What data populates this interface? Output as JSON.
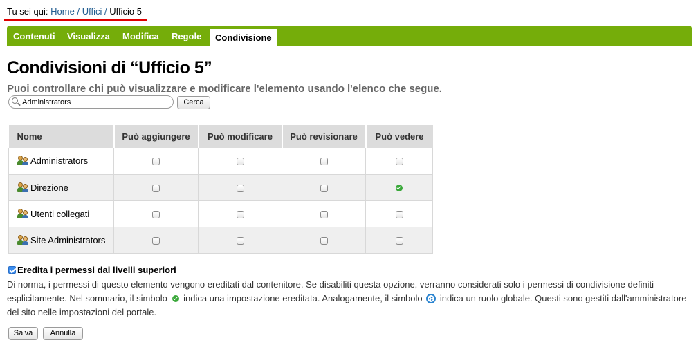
{
  "breadcrumb": {
    "prefix": "Tu sei qui:",
    "items": [
      "Home",
      "Uffici",
      "Ufficio 5"
    ],
    "separator": "/"
  },
  "tabs": [
    "Contenuti",
    "Visualizza",
    "Modifica",
    "Regole",
    "Condivisione"
  ],
  "active_tab": "Condivisione",
  "page": {
    "title": "Condivisioni di “Ufficio 5”",
    "subtitle": "Puoi controllare chi può visualizzare e modificare l'elemento usando l'elenco che segue."
  },
  "search": {
    "value": "Administrators",
    "button_label": "Cerca"
  },
  "table": {
    "headers": [
      "Nome",
      "Può aggiungere",
      "Può modificare",
      "Può revisionare",
      "Può vedere"
    ],
    "rows": [
      {
        "name": "Administrators",
        "permissions": [
          "unchecked",
          "unchecked",
          "unchecked",
          "unchecked"
        ]
      },
      {
        "name": "Direzione",
        "permissions": [
          "unchecked",
          "unchecked",
          "unchecked",
          "inherited"
        ]
      },
      {
        "name": "Utenti collegati",
        "permissions": [
          "unchecked",
          "unchecked",
          "unchecked",
          "unchecked"
        ]
      },
      {
        "name": "Site Administrators",
        "permissions": [
          "unchecked",
          "unchecked",
          "unchecked",
          "unchecked"
        ]
      }
    ]
  },
  "inherit": {
    "label": "Eredita i permessi dai livelli superiori",
    "checked": true,
    "help_part1": "Di norma, i permessi di questo elemento vengono ereditati dal contenitore. Se disabiliti questa opzione, verranno considerati solo i permessi di condivisione definiti esplicitamente. Nel sommario, il simbolo",
    "help_part2": "indica una impostazione ereditata. Analogamente, il simbolo",
    "help_part3": "indica un ruolo globale. Questi sono gestiti dall'amministratore del sito nelle impostazioni del portale."
  },
  "buttons": {
    "save": "Salva",
    "cancel": "Annulla"
  },
  "colors": {
    "tabbar": "#75ad0a",
    "link": "#205c90",
    "accent_underline": "#e00000"
  }
}
